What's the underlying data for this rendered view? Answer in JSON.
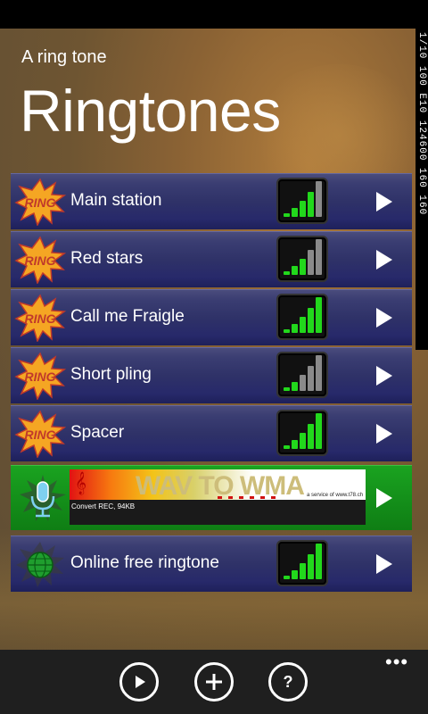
{
  "header": {
    "app_title": "A ring tone",
    "page_title": "Ringtones"
  },
  "side_strip_text": "1/10 100 E10 124600 160 160",
  "ringtones": [
    {
      "label": "Main station",
      "levels": [
        1,
        2,
        3,
        4,
        5
      ],
      "active": 4
    },
    {
      "label": "Red stars",
      "levels": [
        1,
        2,
        3,
        4,
        5
      ],
      "active": 3
    },
    {
      "label": "Call me Fraigle",
      "levels": [
        1,
        2,
        3,
        4,
        5
      ],
      "active": 5
    },
    {
      "label": "Short pling",
      "levels": [
        1,
        2,
        3,
        4,
        5
      ],
      "active": 2
    },
    {
      "label": "Spacer",
      "levels": [
        1,
        2,
        3,
        4,
        5
      ],
      "active": 5
    }
  ],
  "promo": {
    "banner_title": "WAV TO WMA",
    "banner_subtitle": "Convert REC, 94KB",
    "banner_service": "a service of www.t78.ch"
  },
  "online_item": {
    "label": "Online free ringtone",
    "active": 5
  },
  "icons": {
    "ring": "ring-burst-icon",
    "mic": "microphone-icon",
    "globe": "globe-icon",
    "play": "play-icon",
    "add": "add-icon",
    "help": "help-icon",
    "more": "more-icon"
  },
  "appbar": {
    "more_label": "•••"
  },
  "colors": {
    "meter_on": "#22d81c",
    "meter_off": "#8a8a8a",
    "row_bg": "#2f3268",
    "promo_bg": "#14901a",
    "appbar_bg": "#1f1f1f"
  }
}
